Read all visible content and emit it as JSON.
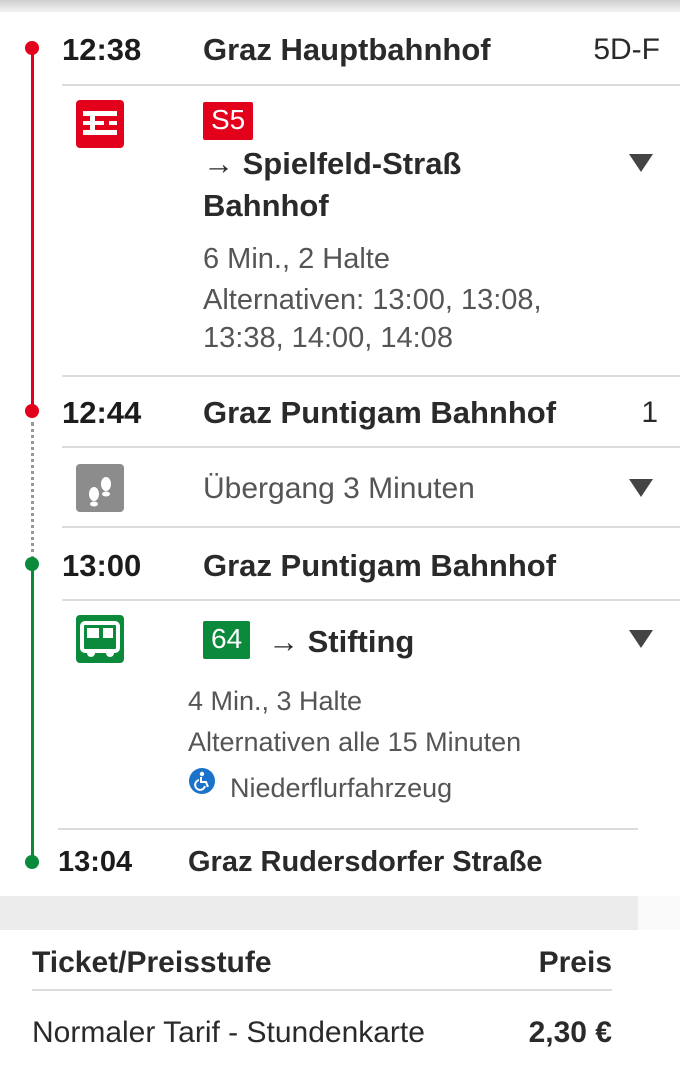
{
  "journey": {
    "stop1": {
      "time": "12:38",
      "station": "Graz Hauptbahnhof",
      "platform": "5D-F"
    },
    "leg1": {
      "line": "S5",
      "line_color": "#e3001b",
      "direction": "→ Spielfeld-Straß Bahnhof",
      "direction_line1": "→ Spielfeld-Straß",
      "direction_line2": "Bahnhof",
      "duration": "6 Min., 2 Halte",
      "alternatives_line1": "Alternativen: 13:00, 13:08,",
      "alternatives_line2": "13:38, 14:00, 14:08",
      "icon": "train-icon"
    },
    "stop2": {
      "time": "12:44",
      "station": "Graz Puntigam Bahnhof",
      "platform": "1"
    },
    "transfer": {
      "text": "Übergang 3 Minuten",
      "icon": "walk-icon"
    },
    "stop3": {
      "time": "13:00",
      "station": "Graz Puntigam Bahnhof"
    },
    "leg2": {
      "line": "64",
      "line_color": "#0a8a3a",
      "direction": "→ Stifting",
      "duration": "4 Min., 3 Halte",
      "alternatives": "Alternativen alle 15 Minuten",
      "accessibility": "Niederflurfahrzeug",
      "icon": "bus-icon"
    },
    "stop4": {
      "time": "13:04",
      "station": "Graz Rudersdorfer Straße"
    }
  },
  "ticket": {
    "header_ticket": "Ticket/Preisstufe",
    "header_price": "Preis",
    "rows": [
      {
        "name": "Normaler Tarif - Stundenkarte",
        "price": "2,30 €"
      }
    ]
  }
}
